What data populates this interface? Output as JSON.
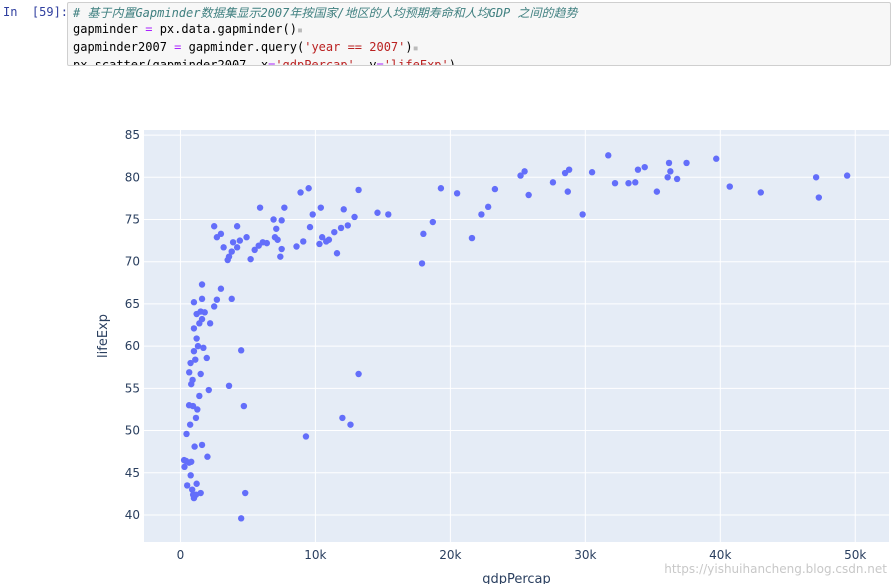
{
  "cell": {
    "prompt": "In  [59]:",
    "comment": "# 基于内置Gapminder数据集显示2007年按国家/地区的人均预期寿命和人均GDP 之间的趋势",
    "line2": {
      "a": "gapminder ",
      "op": "=",
      "b": " px.data.gapminder()"
    },
    "line3": {
      "a": "gapminder2007 ",
      "op": "=",
      "b": " gapminder.query(",
      "s": "'year == 2007'",
      "c": ")"
    },
    "line4": {
      "a": "px.scatter(gapminder2007, x",
      "op1": "=",
      "s1": "'gdpPercap'",
      "m": ", y",
      "op2": "=",
      "s2": "'lifeExp'",
      "c": ")"
    }
  },
  "colors": {
    "marker": "#636efa",
    "plot_bg": "#e5ecf6",
    "grid": "#ffffff",
    "axis_text": "#2a3f5f"
  },
  "chart_data": {
    "type": "scatter",
    "xlabel": "gdpPercap",
    "ylabel": "lifeExp",
    "xlim": [
      -2700,
      52500
    ],
    "ylim": [
      36.8,
      85.6
    ],
    "xticks": [
      0,
      10000,
      20000,
      30000,
      40000,
      50000
    ],
    "xtick_labels": [
      "0",
      "10k",
      "20k",
      "30k",
      "40k",
      "50k"
    ],
    "yticks": [
      40,
      45,
      50,
      55,
      60,
      65,
      70,
      75,
      80,
      85
    ],
    "ytick_labels": [
      "40",
      "45",
      "50",
      "55",
      "60",
      "65",
      "70",
      "75",
      "80",
      "85"
    ],
    "grid": true,
    "points": [
      [
        270,
        46.5
      ],
      [
        420,
        46.4
      ],
      [
        640,
        46.2
      ],
      [
        800,
        46.3
      ],
      [
        300,
        45.7
      ],
      [
        760,
        44.7
      ],
      [
        500,
        43.5
      ],
      [
        870,
        43.0
      ],
      [
        940,
        42.4
      ],
      [
        1150,
        42.4
      ],
      [
        1500,
        42.6
      ],
      [
        1000,
        42.0
      ],
      [
        1200,
        43.7
      ],
      [
        450,
        49.6
      ],
      [
        1050,
        48.1
      ],
      [
        1600,
        48.3
      ],
      [
        2000,
        46.9
      ],
      [
        720,
        50.7
      ],
      [
        1150,
        51.5
      ],
      [
        1250,
        52.5
      ],
      [
        930,
        52.9
      ],
      [
        640,
        53.0
      ],
      [
        1400,
        54.1
      ],
      [
        2100,
        54.8
      ],
      [
        800,
        55.5
      ],
      [
        900,
        56.0
      ],
      [
        650,
        56.9
      ],
      [
        1500,
        56.7
      ],
      [
        750,
        58.0
      ],
      [
        1100,
        58.4
      ],
      [
        1950,
        58.6
      ],
      [
        3600,
        55.3
      ],
      [
        4500,
        59.5
      ],
      [
        1000,
        59.4
      ],
      [
        1300,
        60.0
      ],
      [
        1700,
        59.8
      ],
      [
        1200,
        60.9
      ],
      [
        1000,
        62.1
      ],
      [
        1400,
        62.7
      ],
      [
        2200,
        62.7
      ],
      [
        1200,
        63.8
      ],
      [
        1600,
        63.2
      ],
      [
        1500,
        64.1
      ],
      [
        1800,
        64.0
      ],
      [
        2500,
        64.7
      ],
      [
        1000,
        65.2
      ],
      [
        1600,
        65.6
      ],
      [
        2700,
        65.5
      ],
      [
        3800,
        65.6
      ],
      [
        3000,
        66.8
      ],
      [
        1600,
        67.3
      ],
      [
        4700,
        52.9
      ],
      [
        4500,
        39.6
      ],
      [
        4800,
        42.6
      ],
      [
        9300,
        49.3
      ],
      [
        12000,
        51.5
      ],
      [
        12600,
        50.7
      ],
      [
        13200,
        56.7
      ],
      [
        3500,
        70.2
      ],
      [
        3600,
        70.6
      ],
      [
        3200,
        71.7
      ],
      [
        3800,
        71.2
      ],
      [
        4200,
        71.7
      ],
      [
        4400,
        72.5
      ],
      [
        3900,
        72.3
      ],
      [
        4900,
        72.9
      ],
      [
        5200,
        70.3
      ],
      [
        5500,
        71.4
      ],
      [
        5800,
        71.9
      ],
      [
        6100,
        72.3
      ],
      [
        6400,
        72.2
      ],
      [
        3000,
        73.3
      ],
      [
        2700,
        72.9
      ],
      [
        2500,
        74.2
      ],
      [
        4200,
        74.2
      ],
      [
        5900,
        76.4
      ],
      [
        6900,
        75.0
      ],
      [
        7000,
        72.9
      ],
      [
        7200,
        72.6
      ],
      [
        7400,
        70.6
      ],
      [
        7500,
        71.5
      ],
      [
        7100,
        73.9
      ],
      [
        7500,
        74.9
      ],
      [
        7700,
        76.4
      ],
      [
        8600,
        71.8
      ],
      [
        9100,
        72.4
      ],
      [
        9600,
        74.1
      ],
      [
        10300,
        72.1
      ],
      [
        10500,
        72.9
      ],
      [
        10800,
        72.4
      ],
      [
        10400,
        76.4
      ],
      [
        11400,
        73.5
      ],
      [
        11900,
        74.0
      ],
      [
        12400,
        74.3
      ],
      [
        12900,
        75.3
      ],
      [
        11600,
        71.0
      ],
      [
        8900,
        78.2
      ],
      [
        9500,
        78.7
      ],
      [
        9800,
        75.6
      ],
      [
        13200,
        78.5
      ],
      [
        12100,
        76.2
      ],
      [
        11000,
        72.6
      ],
      [
        14600,
        75.8
      ],
      [
        15400,
        75.6
      ],
      [
        17900,
        69.8
      ],
      [
        18000,
        73.3
      ],
      [
        18700,
        74.7
      ],
      [
        19300,
        78.7
      ],
      [
        20500,
        78.1
      ],
      [
        21600,
        72.8
      ],
      [
        22300,
        75.6
      ],
      [
        22800,
        76.5
      ],
      [
        23300,
        78.6
      ],
      [
        25200,
        80.2
      ],
      [
        25500,
        80.7
      ],
      [
        25800,
        77.9
      ],
      [
        27600,
        79.4
      ],
      [
        28500,
        80.5
      ],
      [
        28700,
        78.3
      ],
      [
        28800,
        80.9
      ],
      [
        29800,
        75.6
      ],
      [
        30500,
        80.6
      ],
      [
        31700,
        82.6
      ],
      [
        32200,
        79.3
      ],
      [
        33200,
        79.3
      ],
      [
        33700,
        79.4
      ],
      [
        33900,
        80.9
      ],
      [
        34400,
        81.2
      ],
      [
        35300,
        78.3
      ],
      [
        36100,
        80.0
      ],
      [
        36200,
        81.7
      ],
      [
        36300,
        80.7
      ],
      [
        36800,
        79.8
      ],
      [
        37500,
        81.7
      ],
      [
        39700,
        82.2
      ],
      [
        40700,
        78.9
      ],
      [
        43000,
        78.2
      ],
      [
        47100,
        80.0
      ],
      [
        47300,
        77.6
      ],
      [
        49400,
        80.2
      ]
    ]
  },
  "watermark": "https://yishuihancheng.blog.csdn.net"
}
